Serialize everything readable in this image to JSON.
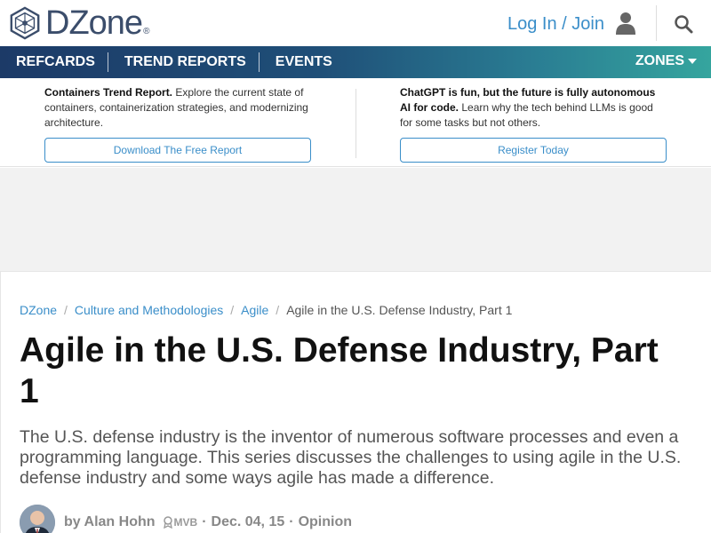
{
  "header": {
    "logo_text": "DZone",
    "logo_reg": "®",
    "login_label": "Log In / Join"
  },
  "nav": {
    "items": [
      {
        "label": "REFCARDS"
      },
      {
        "label": "TREND REPORTS"
      },
      {
        "label": "EVENTS"
      }
    ],
    "zones_label": "ZONES"
  },
  "promo": {
    "left": {
      "bold": "Containers Trend Report.",
      "text": " Explore the current state of containers, containerization strategies, and modernizing architecture.",
      "button": "Download The Free Report"
    },
    "right": {
      "bold": "ChatGPT is fun, but the future is fully autonomous AI for code.",
      "text": " Learn why the tech behind LLMs is good for some tasks but not others.",
      "button": "Register Today"
    }
  },
  "breadcrumb": {
    "items": [
      "DZone",
      "Culture and Methodologies",
      "Agile"
    ],
    "current": "Agile in the U.S. Defense Industry, Part 1"
  },
  "article": {
    "title": "Agile in the U.S. Defense Industry, Part 1",
    "subtitle": "The U.S. defense industry is the inventor of numerous software processes and even a programming language. This series discusses the challenges to using agile in the U.S. defense industry and some ways agile has made a difference.",
    "author": "by Alan Hohn",
    "badge": "MVB",
    "date": "Dec. 04, 15",
    "category": "Opinion",
    "separator": "·"
  },
  "colors": {
    "link": "#3a8ec9",
    "logo": "#3b4d6b",
    "nav_start": "#1c3a67",
    "nav_end": "#35a59e"
  },
  "icons": [
    "dzone-logo-icon",
    "user-icon",
    "search-icon",
    "caret-down-icon",
    "mvb-badge-icon"
  ]
}
